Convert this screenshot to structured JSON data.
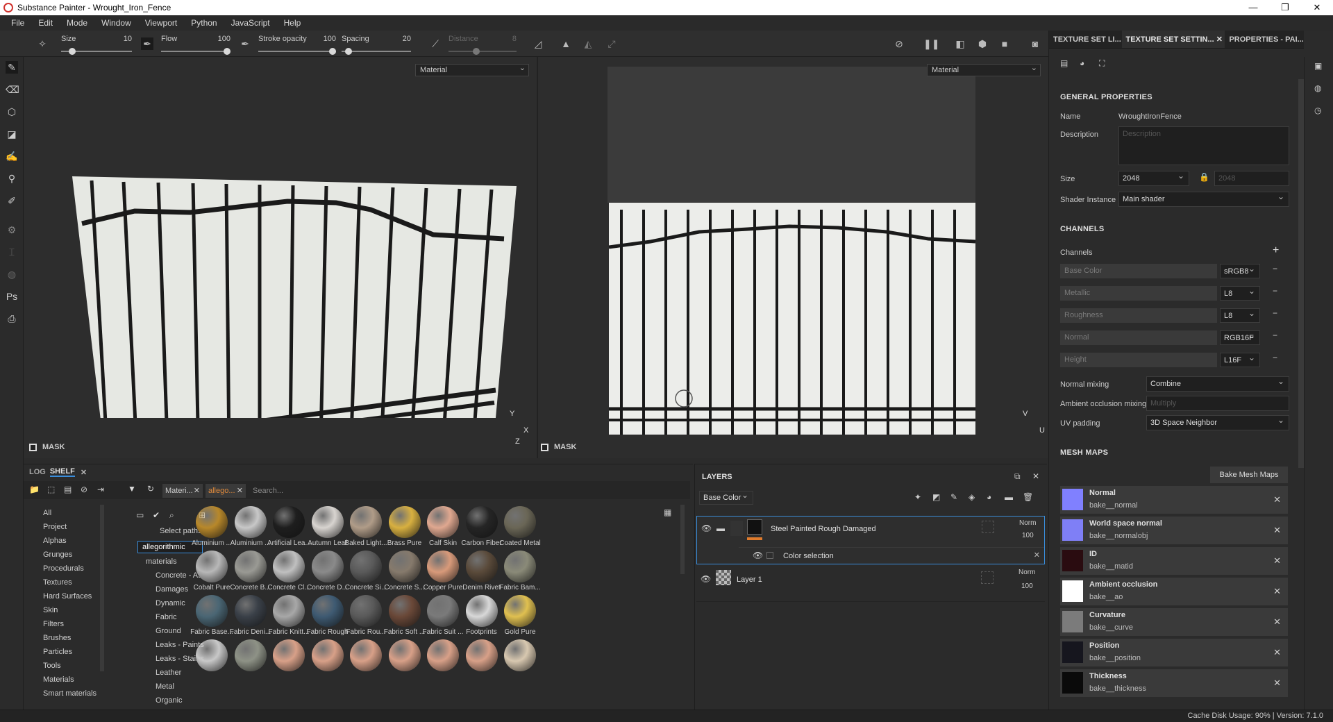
{
  "window": {
    "title": "Substance Painter - Wrought_Iron_Fence",
    "min": "—",
    "max": "❐",
    "close": "✕"
  },
  "menu": [
    "File",
    "Edit",
    "Mode",
    "Window",
    "Viewport",
    "Python",
    "JavaScript",
    "Help"
  ],
  "toolbar": {
    "size": {
      "label": "Size",
      "value": "10",
      "level": 0.12
    },
    "flow": {
      "label": "Flow",
      "value": "100",
      "level": 1.0
    },
    "stroke_opacity": {
      "label": "Stroke opacity",
      "value": "100",
      "level": 1.0
    },
    "spacing": {
      "label": "Spacing",
      "value": "20",
      "level": 0.05
    },
    "distance": {
      "label": "Distance",
      "value": "8",
      "level": 0.4
    }
  },
  "viewport3d": {
    "material_select": "Material",
    "mask_label": "MASK",
    "axis_y": "Y",
    "axis_x": "X",
    "axis_z": "Z"
  },
  "viewport2d": {
    "material_select": "Material",
    "mask_label": "MASK",
    "axis_v": "V",
    "axis_u": "U"
  },
  "right_panel": {
    "tabs": [
      "TEXTURE SET LI...",
      "TEXTURE SET SETTIN...",
      "✕",
      "PROPERTIES - PAI..."
    ],
    "general_title": "GENERAL PROPERTIES",
    "name_label": "Name",
    "name_value": "WroughtIronFence",
    "description_label": "Description",
    "description_placeholder": "Description",
    "size_label": "Size",
    "size_value": "2048",
    "size_value2": "2048",
    "shader_label": "Shader Instance",
    "shader_value": "Main shader",
    "channels_title": "CHANNELS",
    "channels_label": "Channels",
    "channels": [
      {
        "name": "Base Color",
        "format": "sRGB8"
      },
      {
        "name": "Metallic",
        "format": "L8"
      },
      {
        "name": "Roughness",
        "format": "L8"
      },
      {
        "name": "Normal",
        "format": "RGB16F"
      },
      {
        "name": "Height",
        "format": "L16F"
      }
    ],
    "normal_mixing_label": "Normal mixing",
    "normal_mixing_value": "Combine",
    "ao_mixing_label": "Ambient occlusion mixing",
    "ao_mixing_value": "Multiply",
    "uv_padding_label": "UV padding",
    "uv_padding_value": "3D Space Neighbor",
    "mesh_maps_title": "MESH MAPS",
    "bake_button": "Bake Mesh Maps",
    "mesh_maps": [
      {
        "name": "Normal",
        "file": "bake__normal",
        "color": "#8080ff"
      },
      {
        "name": "World space normal",
        "file": "bake__normalobj",
        "color": "#7f7ff6"
      },
      {
        "name": "ID",
        "file": "bake__matid",
        "color": "#2a0c10"
      },
      {
        "name": "Ambient occlusion",
        "file": "bake__ao",
        "color": "#ffffff"
      },
      {
        "name": "Curvature",
        "file": "bake__curve",
        "color": "#7b7b7b"
      },
      {
        "name": "Position",
        "file": "bake__position",
        "color": "#16161e"
      },
      {
        "name": "Thickness",
        "file": "bake__thickness",
        "color": "#0a0a0a"
      }
    ]
  },
  "shelf": {
    "tabs": [
      "LOG",
      "SHELF"
    ],
    "filter1": "Materi...",
    "filter2": "allego...",
    "search_placeholder": "Search...",
    "select_paths": "Select paths",
    "categories": [
      "All",
      "Project",
      "Alphas",
      "Grunges",
      "Procedurals",
      "Textures",
      "Hard Surfaces",
      "Skin",
      "Filters",
      "Brushes",
      "Particles",
      "Tools",
      "Materials",
      "Smart materials"
    ],
    "tree_root": "allegorithmic",
    "tree_folder": "materials",
    "tree_items": [
      "Concrete - As...",
      "Damages",
      "Dynamic",
      "Fabric",
      "Ground",
      "Leaks - Paints",
      "Leaks - Stains",
      "Leather",
      "Metal",
      "Organic"
    ],
    "materials": [
      {
        "name": "Aluminium ...",
        "color": "#b8882a"
      },
      {
        "name": "Aluminium ...",
        "color": "#c8c8c8"
      },
      {
        "name": "Artificial Lea...",
        "color": "#1e1e1e"
      },
      {
        "name": "Autumn Leaf",
        "color": "#d8d4d0"
      },
      {
        "name": "Baked Light...",
        "color": "#b09c88"
      },
      {
        "name": "Brass Pure",
        "color": "#d8b040"
      },
      {
        "name": "Calf Skin",
        "color": "#e0a890"
      },
      {
        "name": "Carbon Fiber",
        "color": "#252525"
      },
      {
        "name": "Coated Metal",
        "color": "#6a6656"
      },
      {
        "name": "Cobalt Pure",
        "color": "#b8b8b8"
      },
      {
        "name": "Concrete B...",
        "color": "#9a9a94"
      },
      {
        "name": "Concrete Cl...",
        "color": "#c0c0c0"
      },
      {
        "name": "Concrete D...",
        "color": "#8a8a8a"
      },
      {
        "name": "Concrete Si...",
        "color": "#5a5a5a"
      },
      {
        "name": "Concrete S...",
        "color": "#867a6c"
      },
      {
        "name": "Copper Pure",
        "color": "#d89a7a"
      },
      {
        "name": "Denim Rivet",
        "color": "#5a4a3a"
      },
      {
        "name": "Fabric Bam...",
        "color": "#8a8a78"
      },
      {
        "name": "Fabric Base...",
        "color": "#4a6674"
      },
      {
        "name": "Fabric Deni...",
        "color": "#3a4048"
      },
      {
        "name": "Fabric Knitt...",
        "color": "#a8a8a8"
      },
      {
        "name": "Fabric Rough",
        "color": "#3e5a72"
      },
      {
        "name": "Fabric Rou...",
        "color": "#5a5a5a"
      },
      {
        "name": "Fabric Soft ...",
        "color": "#6a4838"
      },
      {
        "name": "Fabric Suit ...",
        "color": "#7a7a7a"
      },
      {
        "name": "Footprints",
        "color": "#d8d8d8"
      },
      {
        "name": "Gold Pure",
        "color": "#e0c050"
      },
      {
        "name": "",
        "color": "#c8c8c8"
      },
      {
        "name": "",
        "color": "#8e9286"
      },
      {
        "name": "",
        "color": "#d8a088"
      },
      {
        "name": "",
        "color": "#d8a088"
      },
      {
        "name": "",
        "color": "#d8a088"
      },
      {
        "name": "",
        "color": "#d8a088"
      },
      {
        "name": "",
        "color": "#d8a088"
      },
      {
        "name": "",
        "color": "#d8a088"
      },
      {
        "name": "",
        "color": "#d8c8b0"
      }
    ]
  },
  "layers": {
    "title": "LAYERS",
    "channel_select": "Base Color",
    "items": [
      {
        "name": "Steel Painted Rough Damaged",
        "blend": "Norm",
        "opacity": "100"
      },
      {
        "name": "Color selection"
      },
      {
        "name": "Layer 1",
        "blend": "Norm",
        "opacity": "100"
      }
    ]
  },
  "status": {
    "text": "Cache Disk Usage:   90% | Version: 7.1.0"
  }
}
